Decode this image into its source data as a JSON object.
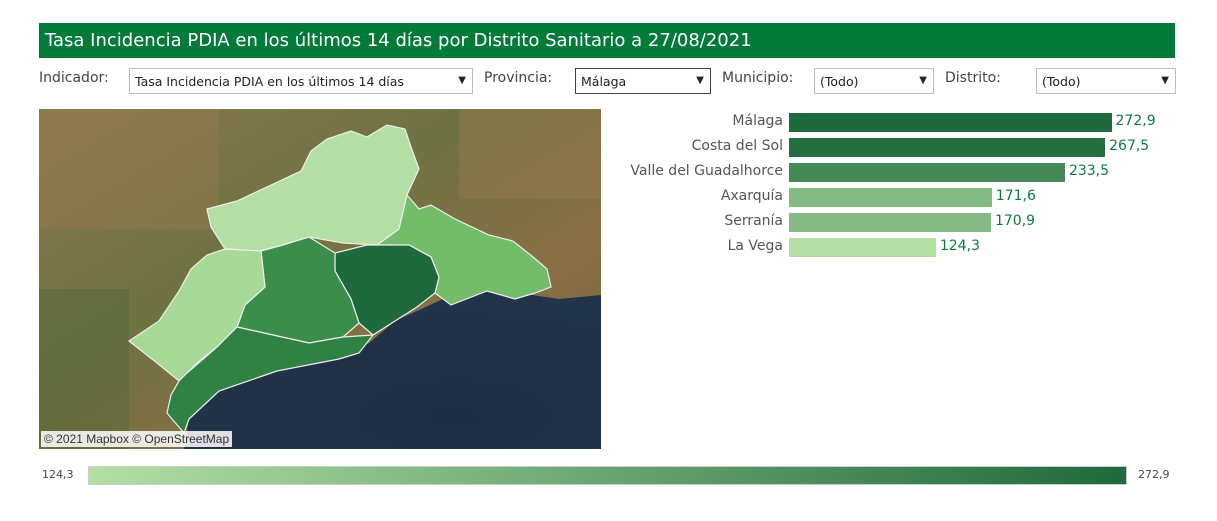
{
  "title": "Tasa Incidencia PDIA en los últimos 14 días por Distrito Sanitario a 27/08/2021",
  "filters": {
    "indicador": {
      "label": "Indicador:",
      "value": "Tasa Incidencia PDIA en los últimos 14 días"
    },
    "provincia": {
      "label": "Provincia:",
      "value": "Málaga"
    },
    "municipio": {
      "label": "Municipio:",
      "value": "(Todo)"
    },
    "distrito": {
      "label": "Distrito:",
      "value": "(Todo)"
    }
  },
  "map": {
    "attribution": "© 2021 Mapbox  © OpenStreetMap"
  },
  "colors": {
    "title_bg": "#017a3a",
    "scale_low": "#b3dfa5",
    "scale_high": "#1f6a3c",
    "value_text": "#0e7a3e"
  },
  "chart_data": {
    "type": "bar",
    "orientation": "horizontal",
    "categories": [
      "Málaga",
      "Costa del Sol",
      "Valle del Guadalhorce",
      "Axarquía",
      "Serranía",
      "La Vega"
    ],
    "values": [
      272.9,
      267.5,
      233.5,
      171.6,
      170.9,
      124.3
    ],
    "value_labels": [
      "272,9",
      "267,5",
      "233,5",
      "171,6",
      "170,9",
      "124,3"
    ],
    "xlim": [
      0,
      330
    ]
  },
  "legend": {
    "min": "124,3",
    "max": "272,9"
  }
}
